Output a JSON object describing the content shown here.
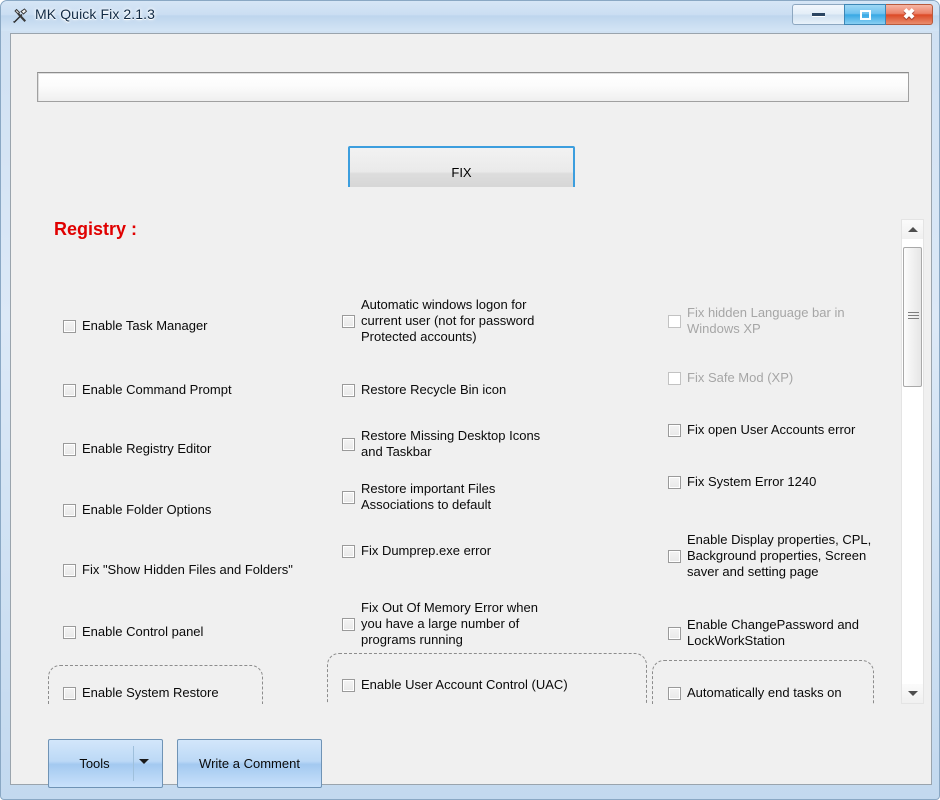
{
  "window": {
    "title": "MK Quick Fix 2.1.3",
    "icon": "tools-hammer-wrench-icon",
    "controls": {
      "minimize": "minimize-icon",
      "restore": "restore-icon",
      "close": "close-icon"
    }
  },
  "toolbar": {
    "path_value": "",
    "path_placeholder": "",
    "fix_label": "FIX"
  },
  "sections": {
    "registry_heading": "Registry :",
    "heading_color": "#e00000"
  },
  "columns": {
    "left": [
      {
        "label": "Enable Task Manager",
        "checked": false,
        "disabled": false
      },
      {
        "label": "Enable Command Prompt",
        "checked": false,
        "disabled": false
      },
      {
        "label": "Enable Registry Editor",
        "checked": false,
        "disabled": false
      },
      {
        "label": "Enable Folder Options",
        "checked": false,
        "disabled": false
      },
      {
        "label": "Fix \"Show Hidden Files and Folders\"",
        "checked": false,
        "disabled": false
      },
      {
        "label": "Enable Control panel",
        "checked": false,
        "disabled": false
      },
      {
        "label": "Enable System Restore",
        "checked": false,
        "disabled": false
      }
    ],
    "middle": [
      {
        "label": "Automatic windows logon for\ncurrent user (not for password\nProtected accounts)",
        "checked": false,
        "disabled": false
      },
      {
        "label": "Restore Recycle Bin icon",
        "checked": false,
        "disabled": false
      },
      {
        "label": "Restore Missing Desktop Icons\nand Taskbar",
        "checked": false,
        "disabled": false
      },
      {
        "label": "Restore important  Files\nAssociations to default",
        "checked": false,
        "disabled": false
      },
      {
        "label": "Fix Dumprep.exe error",
        "checked": false,
        "disabled": false
      },
      {
        "label": "Fix Out Of Memory Error when\nyou have a large number of\nprograms running",
        "checked": false,
        "disabled": false
      },
      {
        "label": "Enable User Account Control (UAC)",
        "checked": false,
        "disabled": false
      }
    ],
    "right": [
      {
        "label": "Fix hidden Language bar in\nWindows XP",
        "checked": false,
        "disabled": true
      },
      {
        "label": "Fix Safe Mod (XP)",
        "checked": false,
        "disabled": true
      },
      {
        "label": "Fix open User Accounts error",
        "checked": false,
        "disabled": false
      },
      {
        "label": "Fix System Error  1240",
        "checked": false,
        "disabled": false
      },
      {
        "label": "Enable Display properties, CPL,\nBackground properties, Screen\nsaver and setting page",
        "checked": false,
        "disabled": false
      },
      {
        "label": "Enable ChangePassword and\nLockWorkStation",
        "checked": false,
        "disabled": false
      },
      {
        "label": "Automatically end tasks on",
        "checked": false,
        "disabled": false
      }
    ]
  },
  "scrollbar": {
    "up_icon": "chevron-up-icon",
    "down_icon": "chevron-down-icon",
    "thumb_grip": "grip-lines-icon"
  },
  "footer": {
    "tools_label": "Tools",
    "tools_caret": "chevron-down-icon",
    "comment_label": "Write a Comment"
  }
}
